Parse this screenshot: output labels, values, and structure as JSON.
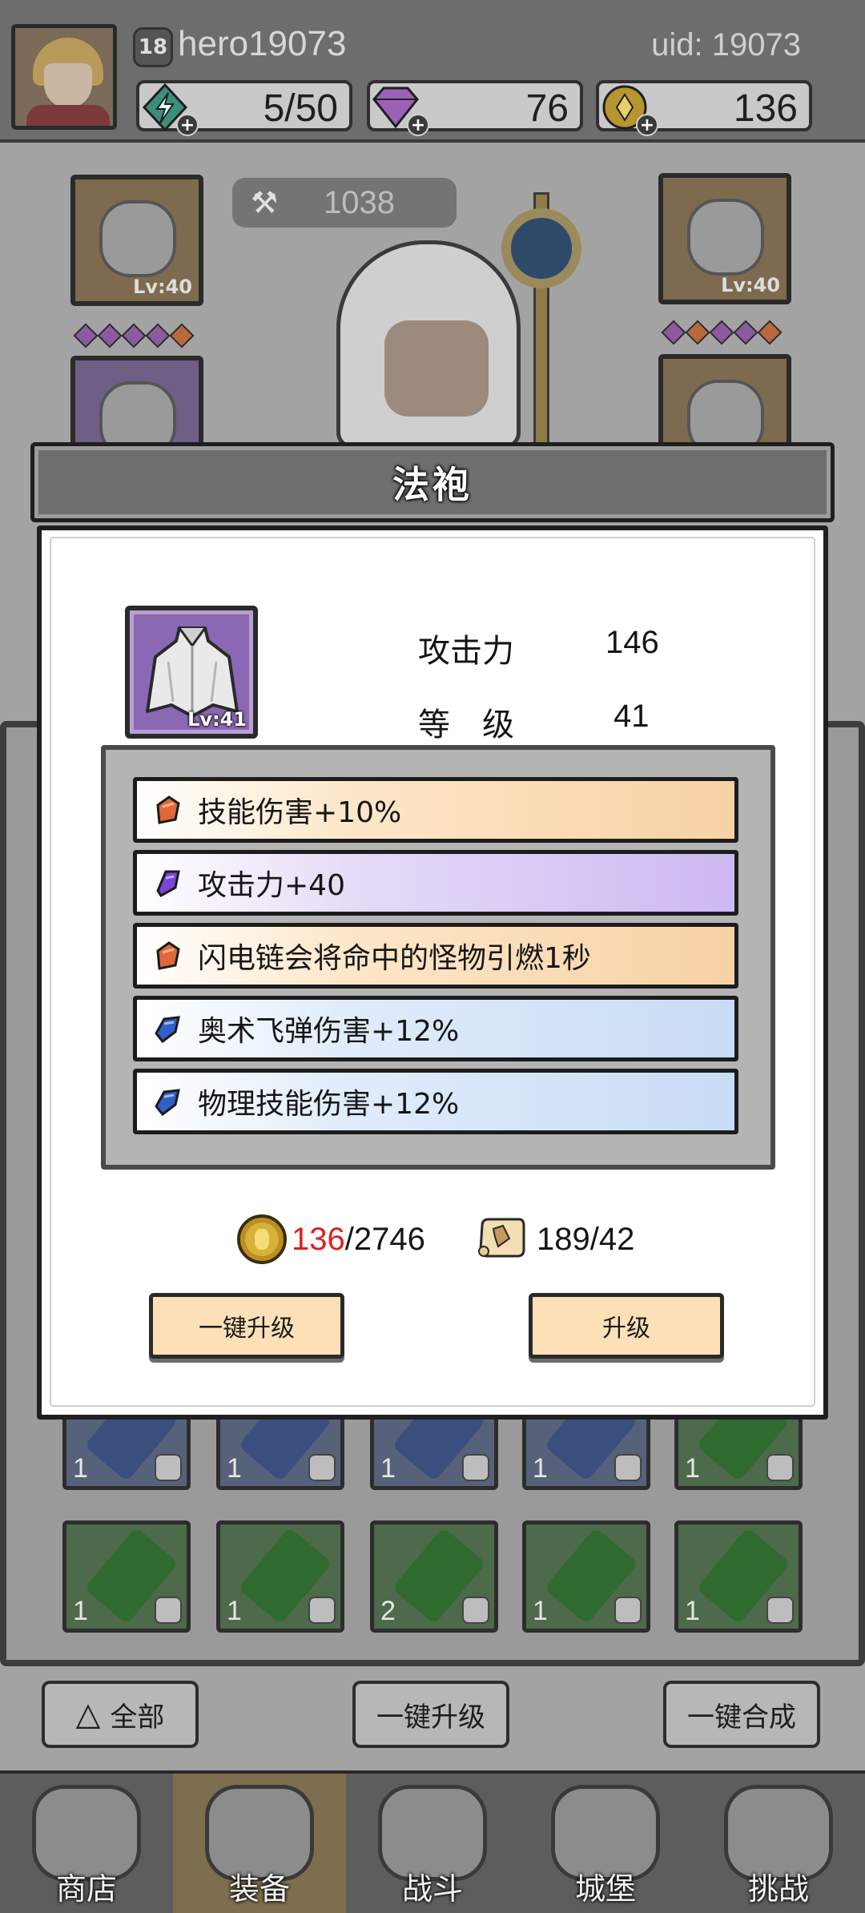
{
  "header": {
    "player_level": "18",
    "player_name": "hero19073",
    "uid": "uid: 19073",
    "energy": "5/50",
    "gems": "76",
    "coins": "136",
    "plus": "+"
  },
  "power": "1038",
  "equipment": {
    "helmet_lv": "Lv:40",
    "arm_lv": "Lv:40"
  },
  "modal": {
    "title": "法袍",
    "item_lv": "Lv:41",
    "stats": [
      {
        "label": "攻击力",
        "value": "146"
      },
      {
        "label": "等　级",
        "value": "41"
      }
    ],
    "affixes": [
      {
        "text": "技能伤害+10%",
        "quality": "orange"
      },
      {
        "text": "攻击力+40",
        "quality": "purple"
      },
      {
        "text": "闪电链会将命中的怪物引燃1秒",
        "quality": "orange"
      },
      {
        "text": "奥术飞弹伤害+12%",
        "quality": "blue"
      },
      {
        "text": "物理技能伤害+12%",
        "quality": "blue"
      }
    ],
    "cost": {
      "coin_have": "136",
      "coin_need": "/2746",
      "scroll": "189/42"
    },
    "buttons": {
      "one_click_upgrade": "一键升级",
      "upgrade": "升级"
    }
  },
  "inventory": {
    "row1_counts": [
      "1",
      "1",
      "1",
      "1",
      "1"
    ],
    "row2_counts": [
      "1",
      "1",
      "2",
      "1",
      "1"
    ]
  },
  "bottom_actions": {
    "all": "全部",
    "one_click_upgrade": "一键升级",
    "one_click_merge": "一键合成"
  },
  "nav": {
    "shop": "商店",
    "equipment": "装备",
    "battle": "战斗",
    "castle": "城堡",
    "challenge": "挑战"
  },
  "colors": {
    "orange_gem": "#e0673a",
    "purple_gem": "#7b45d6",
    "blue_gem": "#2f5fc8",
    "cost_shortage": "#e01f1f"
  }
}
